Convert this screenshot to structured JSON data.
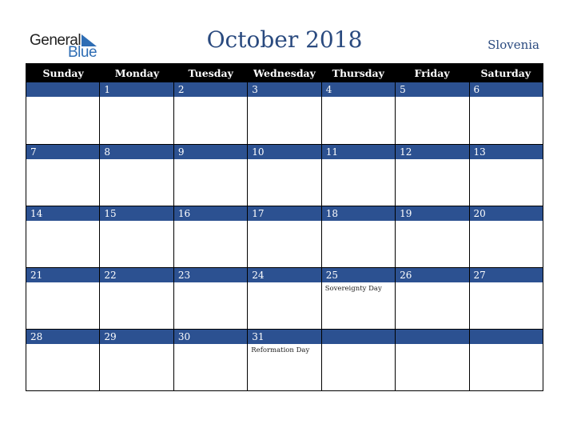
{
  "logo": {
    "word1": "General",
    "word2": "Blue"
  },
  "title": "October 2018",
  "country": "Slovenia",
  "colors": {
    "accent": "#2c5191",
    "header_bg": "#000000",
    "title": "#2a4a7f"
  },
  "weekdays": [
    "Sunday",
    "Monday",
    "Tuesday",
    "Wednesday",
    "Thursday",
    "Friday",
    "Saturday"
  ],
  "weeks": [
    [
      {
        "day": ""
      },
      {
        "day": "1"
      },
      {
        "day": "2"
      },
      {
        "day": "3"
      },
      {
        "day": "4"
      },
      {
        "day": "5"
      },
      {
        "day": "6"
      }
    ],
    [
      {
        "day": "7"
      },
      {
        "day": "8"
      },
      {
        "day": "9"
      },
      {
        "day": "10"
      },
      {
        "day": "11"
      },
      {
        "day": "12"
      },
      {
        "day": "13"
      }
    ],
    [
      {
        "day": "14"
      },
      {
        "day": "15"
      },
      {
        "day": "16"
      },
      {
        "day": "17"
      },
      {
        "day": "18"
      },
      {
        "day": "19"
      },
      {
        "day": "20"
      }
    ],
    [
      {
        "day": "21"
      },
      {
        "day": "22"
      },
      {
        "day": "23"
      },
      {
        "day": "24"
      },
      {
        "day": "25",
        "event": "Sovereignty Day"
      },
      {
        "day": "26"
      },
      {
        "day": "27"
      }
    ],
    [
      {
        "day": "28"
      },
      {
        "day": "29"
      },
      {
        "day": "30"
      },
      {
        "day": "31",
        "event": "Reformation Day"
      },
      {
        "day": ""
      },
      {
        "day": ""
      },
      {
        "day": ""
      }
    ]
  ]
}
